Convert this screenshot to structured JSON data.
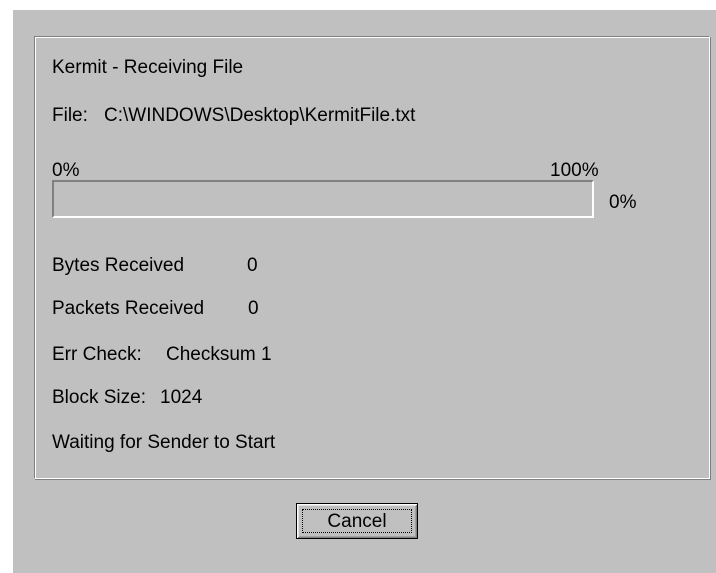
{
  "dialog": {
    "title": "Kermit - Receiving File",
    "file_label": "File:",
    "file_path": "C:\\WINDOWS\\Desktop\\KermitFile.txt"
  },
  "progress": {
    "min_label": "0%",
    "max_label": "100%",
    "percent_label": "0%",
    "value_percent": 0
  },
  "stats": {
    "bytes_label": "Bytes Received",
    "bytes_value": "0",
    "packets_label": "Packets Received",
    "packets_value": "0",
    "errcheck_label": "Err Check:",
    "errcheck_value": "Checksum 1",
    "blocksize_label": "Block Size:",
    "blocksize_value": "1024"
  },
  "status": {
    "message": "Waiting for Sender to Start"
  },
  "buttons": {
    "cancel_label": "Cancel"
  },
  "colors": {
    "face": "#c0c0c0",
    "highlight": "#ffffff",
    "shadow": "#808080",
    "progress_fill": "#000080"
  }
}
